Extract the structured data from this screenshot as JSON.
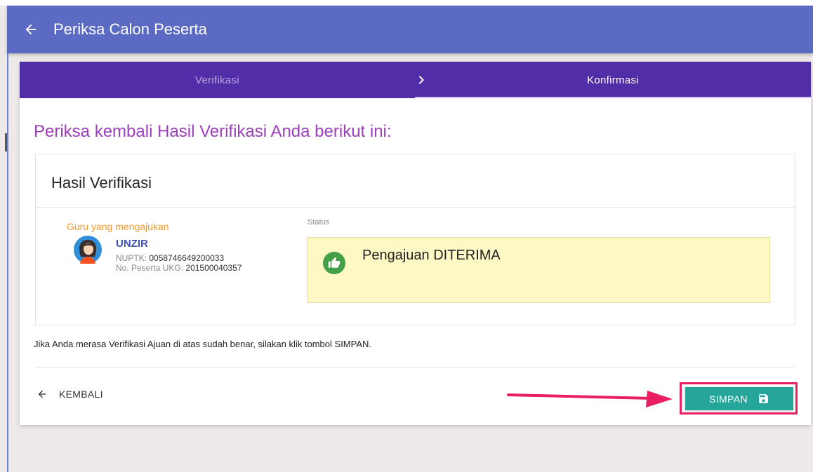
{
  "appbar": {
    "title": "Periksa Calon Peserta",
    "back_icon": "arrow-left-icon"
  },
  "stepper": {
    "steps": [
      {
        "label": "Verifikasi",
        "state": "done"
      },
      {
        "label": "Konfirmasi",
        "state": "active"
      }
    ],
    "separator_icon": "chevron-right-icon"
  },
  "heading": "Periksa kembali Hasil Verifikasi Anda berikut ini:",
  "panel": {
    "title": "Hasil Verifikasi",
    "guru": {
      "label": "Guru yang mengajukan",
      "name": "UNZIR",
      "nuptk_label": "NUPTK:",
      "nuptk": "0058746649200033",
      "peserta_label": "No. Peserta UKG:",
      "peserta": "201500040357"
    },
    "status": {
      "label": "Status",
      "text": "Pengajuan DITERIMA",
      "icon": "thumbs-up-icon"
    }
  },
  "note": "Jika Anda merasa Verifikasi Ajuan di atas sudah benar, silakan klik tombol SIMPAN.",
  "actions": {
    "back_label": "KEMBALI",
    "save_label": "SIMPAN"
  },
  "colors": {
    "appbar": "#5b6ac3",
    "stepper": "#512da8",
    "heading": "#9c3fba",
    "guru_label": "#f29a2e",
    "save_button": "#26a69a",
    "highlight": "#e91e63",
    "status_bg": "#fdf8c4"
  }
}
